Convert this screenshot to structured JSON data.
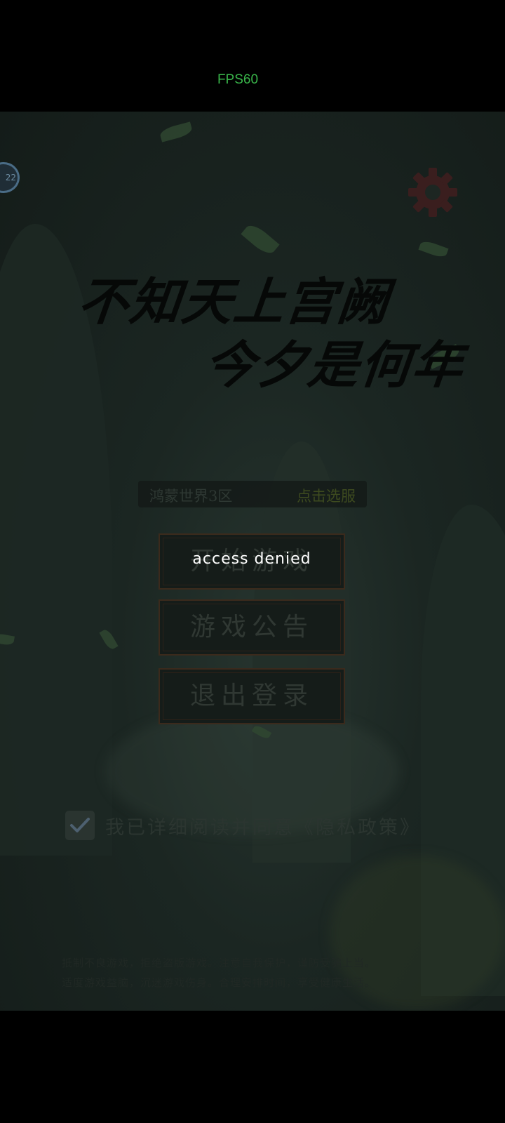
{
  "status_bar": {
    "fps_label": "FPS60"
  },
  "scene": {
    "avatar_level": "22",
    "title_line1": "不知天上宫阙",
    "title_line2": "今夕是何年",
    "server": {
      "name": "鸿蒙世界3区",
      "select_label": "点击选服"
    },
    "buttons": {
      "start": "开始游戏",
      "notice": "游戏公告",
      "logout": "退出登录"
    },
    "toast": "access denied",
    "agreement": {
      "checked": true,
      "text": "我已详细阅读并同意《隐私政策》"
    },
    "health_notice": {
      "line1": "抵制不良游戏，拒绝盗版游戏。注意自我保护，谨防受骗上当。",
      "line2": "适度游戏益脑，沉迷游戏伤身。合理安排时间，享受健康生活。"
    },
    "colors": {
      "fps": "#39b54a",
      "scene_bg": "#1b2622",
      "button_border": "#3b2a1c"
    },
    "icons": [
      "settings-gear-icon",
      "checkmark-icon",
      "avatar-badge"
    ]
  }
}
